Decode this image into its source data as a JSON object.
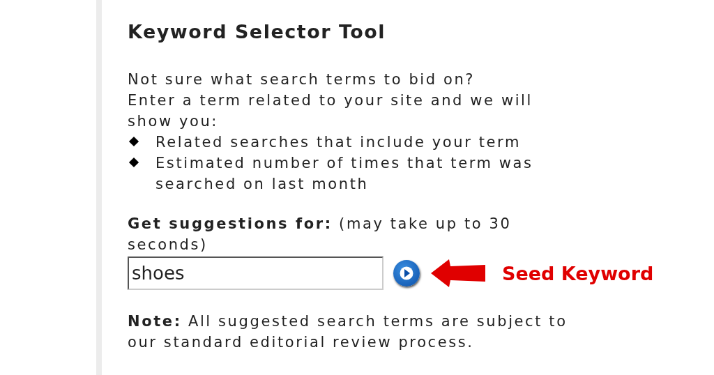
{
  "title": "Keyword Selector Tool",
  "intro": [
    "Not sure what search terms to bid on?",
    "Enter a term related to your site and we will show you:"
  ],
  "bullets": [
    "Related searches that include your term",
    "Estimated number of times that term was searched on last month"
  ],
  "suggest": {
    "label": "Get suggestions for:",
    "hint": "(may take up to 30 seconds)",
    "value": "shoes"
  },
  "note": "**Note:** All suggested search terms are subject to our standard editorial review process.",
  "annotation": "Seed Keyword"
}
